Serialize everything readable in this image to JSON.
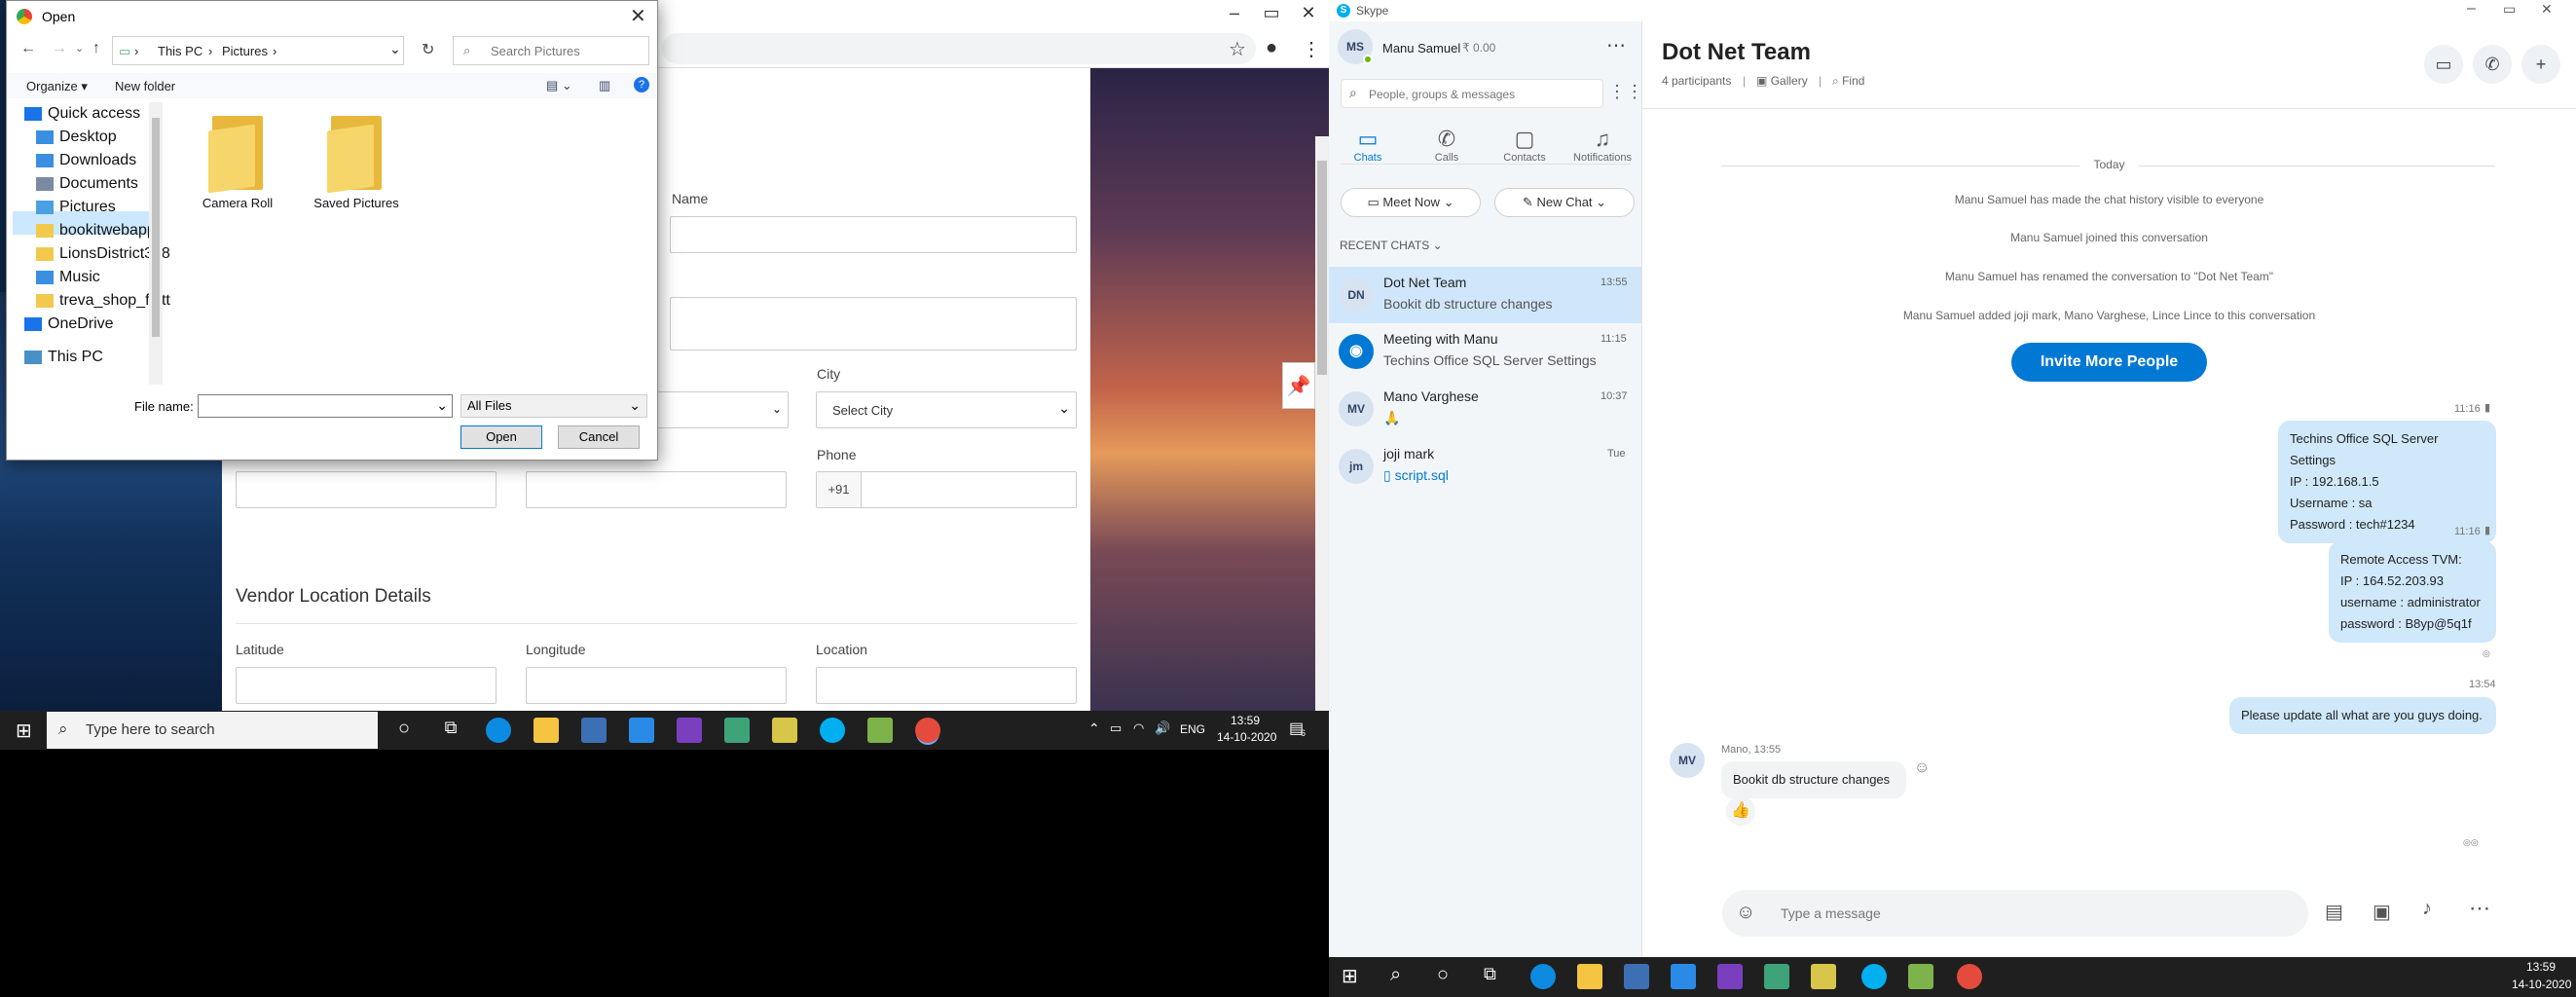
{
  "chrome": {
    "window_buttons": [
      "–",
      "▭",
      "✕"
    ]
  },
  "form": {
    "name_label": "Name",
    "city_label": "City",
    "city_select": "Select City",
    "phone_label": "Phone",
    "phone_prefix": "+91",
    "section_title": "Vendor Location Details",
    "latitude_label": "Latitude",
    "longitude_label": "Longitude",
    "location_label": "Location"
  },
  "dialog": {
    "title": "Open",
    "breadcrumb": [
      "This PC",
      "Pictures"
    ],
    "search_placeholder": "Search Pictures",
    "organize": "Organize ▾",
    "new_folder": "New folder",
    "nav": [
      {
        "label": "Quick access",
        "icon": "star-icon"
      },
      {
        "label": "Desktop",
        "icon": "desktop-icon"
      },
      {
        "label": "Downloads",
        "icon": "download-icon"
      },
      {
        "label": "Documents",
        "icon": "document-icon"
      },
      {
        "label": "Pictures",
        "icon": "picture-icon"
      },
      {
        "label": "bookitwebapp",
        "icon": "folder-icon"
      },
      {
        "label": "LionsDistrict318",
        "icon": "folder-icon"
      },
      {
        "label": "Music",
        "icon": "music-icon"
      },
      {
        "label": "treva_shop_flutt",
        "icon": "folder-icon"
      },
      {
        "label": "OneDrive",
        "icon": "cloud-icon"
      },
      {
        "label": "This PC",
        "icon": "computer-icon"
      }
    ],
    "folders": [
      "Camera Roll",
      "Saved Pictures"
    ],
    "file_name_label": "File name:",
    "file_name_value": "",
    "file_type": "All Files",
    "open_button": "Open",
    "cancel_button": "Cancel"
  },
  "taskbar_left": {
    "search_placeholder": "Type here to search",
    "lang": "ENG",
    "time": "13:59",
    "date": "14-10-2020",
    "notif_count": "6"
  },
  "skype": {
    "app_title": "Skype",
    "user_initials": "MS",
    "user_name": "Manu Samuel",
    "credit": "₹ 0.00",
    "search_placeholder": "People, groups & messages",
    "tabs": [
      {
        "label": "Chats",
        "icon": "chat-icon"
      },
      {
        "label": "Calls",
        "icon": "phone-icon"
      },
      {
        "label": "Contacts",
        "icon": "contacts-icon"
      },
      {
        "label": "Notifications",
        "icon": "bell-icon"
      }
    ],
    "meet_now": "Meet Now",
    "new_chat": "New Chat",
    "recent_chats_label": "RECENT CHATS",
    "chats": [
      {
        "initials": "DN",
        "name": "Dot Net Team",
        "preview": "Bookit db structure changes",
        "time": "13:55"
      },
      {
        "initials": "",
        "name": "Meeting with Manu",
        "preview": "Techins Office SQL Server Settings",
        "time": "11:15"
      },
      {
        "initials": "MV",
        "name": "Mano Varghese",
        "preview": "🙏",
        "time": "10:37"
      },
      {
        "initials": "jm",
        "name": "joji mark",
        "preview": "script.sql",
        "time": "Tue"
      }
    ],
    "conversation": {
      "title": "Dot Net Team",
      "participants": "4 participants",
      "gallery": "Gallery",
      "find": "Find",
      "day_label": "Today",
      "system_messages": [
        "Manu Samuel has made the chat history visible to everyone",
        "Manu Samuel joined this conversation",
        "Manu Samuel has renamed the conversation to \"Dot Net Team\"",
        "Manu Samuel added joji mark, Mano Varghese, Lince Lince to this conversation"
      ],
      "invite_button": "Invite More People",
      "msg1_time": "11:16",
      "msg1_lines": [
        "Techins Office SQL Server Settings",
        "IP : 192.168.1.5",
        "Username : sa",
        "Password : tech#1234"
      ],
      "msg2_time": "11:16",
      "msg2_lines": [
        "Remote Access TVM:",
        "IP : 164.52.203.93",
        "username : administrator",
        "password : B8yp@5q1f"
      ],
      "msg3_time": "13:54",
      "msg3_text": "Please update all what are you guys doing.",
      "incoming_initials": "MV",
      "incoming_meta": "Mano, 13:55",
      "incoming_text": "Bookit db structure changes",
      "incoming_reaction": "👍",
      "compose_placeholder": "Type a message"
    }
  },
  "taskbar_right": {
    "time": "13:59",
    "date": "14-10-2020"
  }
}
